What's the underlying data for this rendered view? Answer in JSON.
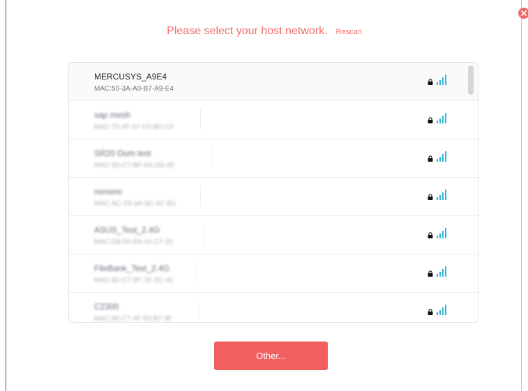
{
  "dialog": {
    "title": "Please select your host network.",
    "rescan_label": "Rescan",
    "other_label": "Other..."
  },
  "networks": [
    {
      "ssid": "MERCUSYS_A9E4",
      "mac": "MAC:50-3A-A0-B7-A9-E4",
      "secured": true,
      "signal": 4
    },
    {
      "ssid": "sap mesh",
      "mac": "MAC:70-4F-57-C0-B0-C0",
      "secured": true,
      "signal": 4
    },
    {
      "ssid": "SR20 Dom test",
      "mac": "MAC:50-C7-BF-8A-D0-4E",
      "secured": true,
      "signal": 4
    },
    {
      "ssid": "nonono",
      "mac": "MAC:AC-29-3A-9C-4C-B3",
      "secured": true,
      "signal": 4
    },
    {
      "ssid": "ASUS_Test_2.4G",
      "mac": "MAC:D8-50-E6-44-C7-20",
      "secured": true,
      "signal": 4
    },
    {
      "ssid": "FileBank_Test_2.4G",
      "mac": "MAC:90-C7-6F-7E-2C-4C",
      "secured": true,
      "signal": 4
    },
    {
      "ssid": "C2300",
      "mac": "MAC:90-C7-4F-93-B7-9F",
      "secured": true,
      "signal": 4
    }
  ],
  "colors": {
    "accent": "#f26b6b",
    "button": "#f25f5f",
    "signal": "#2bb8d6",
    "lock": "#111111"
  },
  "icons": {
    "close": "close-icon",
    "lock": "lock-icon",
    "signal": "wifi-signal-icon"
  }
}
